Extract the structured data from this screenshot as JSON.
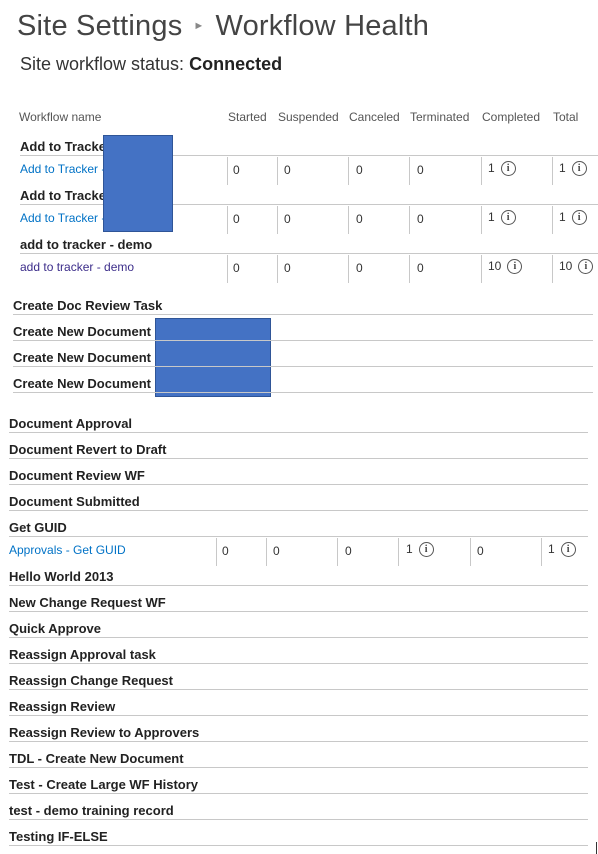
{
  "breadcrumb": {
    "parent": "Site Settings",
    "current": "Workflow Health"
  },
  "status": {
    "label": "Site workflow status:",
    "value": "Connected"
  },
  "columns": [
    "Workflow name",
    "Started",
    "Suspended",
    "Canceled",
    "Terminated",
    "Completed",
    "Total"
  ],
  "rows": [
    {
      "name": "Add to Tracke",
      "instance": "Add to Tracker -",
      "started": "0",
      "suspended": "0",
      "canceled": "0",
      "terminated": "0",
      "completed": "1",
      "total": "1"
    },
    {
      "name": "Add to Tracke",
      "instance": "Add to Tracker -",
      "started": "0",
      "suspended": "0",
      "canceled": "0",
      "terminated": "0",
      "completed": "1",
      "total": "1"
    },
    {
      "name": "add to tracker - demo",
      "instance": "add to tracker - demo",
      "started": "0",
      "suspended": "0",
      "canceled": "0",
      "terminated": "0",
      "completed": "10",
      "total": "10"
    }
  ],
  "group2": [
    "Create Doc Review Task",
    "Create New Document",
    "Create New Document",
    "Create New Document"
  ],
  "group3a": [
    "Document Approval",
    "Document Revert to Draft",
    "Document Review WF",
    "Document Submitted",
    "Get GUID"
  ],
  "guid_row": {
    "instance": "Approvals - Get GUID",
    "v1": "0",
    "v2": "0",
    "v3": "0",
    "v4": "1",
    "v5": "0",
    "v6": "1"
  },
  "group3b": [
    "Hello World 2013",
    "New Change Request WF",
    "Quick Approve",
    "Reassign Approval task",
    "Reassign Change Request",
    "Reassign Review",
    "Reassign Review to Approvers",
    "TDL - Create New Document",
    "Test - Create Large WF History",
    "test - demo training record",
    "Testing IF-ELSE"
  ],
  "icons": {
    "info": "info-circle-icon",
    "separator": "breadcrumb-chevron-icon"
  },
  "colors": {
    "link": "#0072c6",
    "redaction": "#4472c4"
  }
}
